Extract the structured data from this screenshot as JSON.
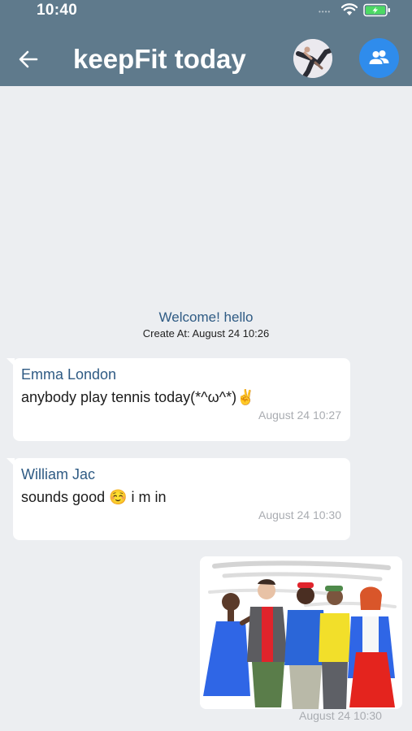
{
  "status_bar": {
    "time": "10:40",
    "signal": "••••"
  },
  "header": {
    "title": "keepFit today"
  },
  "welcome": {
    "title": "Welcome! hello",
    "created": "Create At: August 24 10:26"
  },
  "messages": [
    {
      "sender": "Emma London",
      "text": "anybody play tennis today(*^ω^*)✌️",
      "time": "August 24 10:27"
    },
    {
      "sender": "William Jac",
      "text": "sounds good ☺️ i m in",
      "time": "August 24 10:30"
    }
  ],
  "image_message": {
    "time": "August 24 10:30"
  },
  "colors": {
    "header": "#5f7a8c",
    "accent": "#2f8cec",
    "sender": "#2f5b84",
    "background": "#eceef1"
  }
}
